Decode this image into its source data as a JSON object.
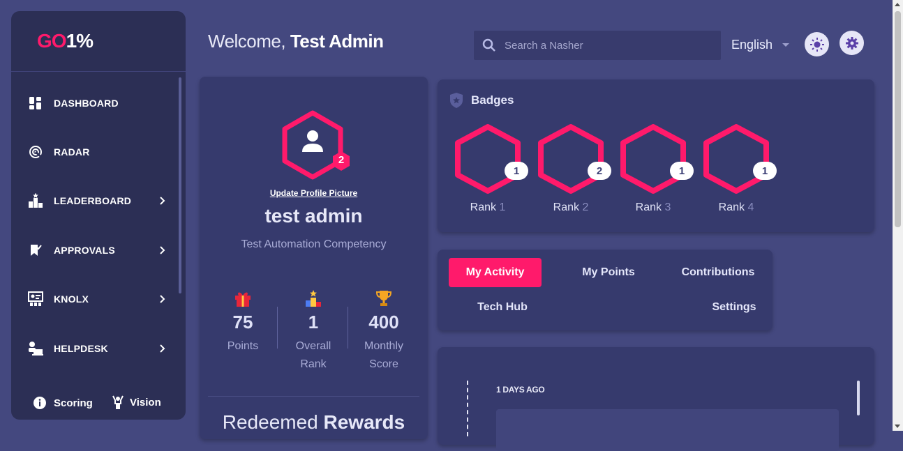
{
  "logo": {
    "part1": "GO",
    "part2": "1%"
  },
  "sidebar": {
    "items": [
      {
        "label": "DASHBOARD",
        "icon": "dashboard-icon",
        "has_submenu": false
      },
      {
        "label": "RADAR",
        "icon": "radar-icon",
        "has_submenu": false
      },
      {
        "label": "LEADERBOARD",
        "icon": "leaderboard-icon",
        "has_submenu": true
      },
      {
        "label": "APPROVALS",
        "icon": "approvals-icon",
        "has_submenu": true
      },
      {
        "label": "KNOLX",
        "icon": "knolx-icon",
        "has_submenu": true
      },
      {
        "label": "HELPDESK",
        "icon": "helpdesk-icon",
        "has_submenu": true
      }
    ],
    "footer": {
      "scoring": "Scoring",
      "vision": "Vision"
    }
  },
  "header": {
    "welcome_prefix": "Welcome,",
    "welcome_name": "Test Admin",
    "search_placeholder": "Search a Nasher",
    "language": "English"
  },
  "profile": {
    "level": "2",
    "update_picture": "Update Profile Picture",
    "name": "test admin",
    "competency": "Test Automation Competency",
    "stats": [
      {
        "value": "75",
        "label": "Points",
        "icon": "gift-icon"
      },
      {
        "value": "1",
        "label": "Overall Rank",
        "icon": "podium-icon"
      },
      {
        "value": "400",
        "label": "Monthly Score",
        "icon": "trophy-icon"
      }
    ],
    "redeemed_prefix": "Redeemed",
    "redeemed_bold": "Rewards"
  },
  "badges": {
    "title": "Badges",
    "items": [
      {
        "label": "Rank",
        "rank": "1",
        "count": "1"
      },
      {
        "label": "Rank",
        "rank": "2",
        "count": "2"
      },
      {
        "label": "Rank",
        "rank": "3",
        "count": "1"
      },
      {
        "label": "Rank",
        "rank": "4",
        "count": "1"
      }
    ]
  },
  "tabs": {
    "my_activity": "My Activity",
    "my_points": "My Points",
    "contributions": "Contributions",
    "tech_hub": "Tech Hub",
    "settings": "Settings"
  },
  "activity": {
    "days_ago": "1 DAYS AGO"
  },
  "colors": {
    "accent": "#ff1a6b",
    "background": "#44487f",
    "card": "#363a6d",
    "sidebar": "#2c2f55"
  }
}
